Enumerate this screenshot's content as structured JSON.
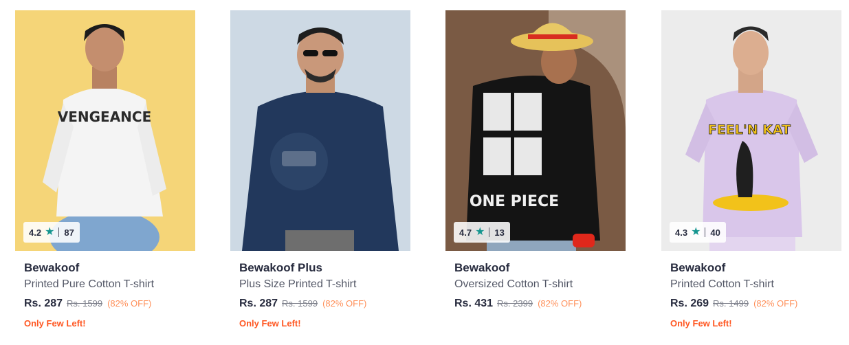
{
  "products": [
    {
      "brand": "Bewakoof",
      "title": "Printed Pure Cotton T-shirt",
      "price": "Rs. 287",
      "mrp": "Rs. 1599",
      "discount": "(82% OFF)",
      "stock_note": "Only Few Left!",
      "rating": "4.2",
      "rating_count": "87",
      "shirt_print": "VENGEANCE",
      "colors": {
        "bg": "#f2cf6b",
        "shirt": "#f4f4f4",
        "print": "#2a2a2a"
      }
    },
    {
      "brand": "Bewakoof Plus",
      "title": "Plus Size Printed T-shirt",
      "price": "Rs. 287",
      "mrp": "Rs. 1599",
      "discount": "(82% OFF)",
      "stock_note": "Only Few Left!",
      "colors": {
        "bg": "#cdd9e4",
        "shirt": "#22385c",
        "print": "#5d6f8a"
      }
    },
    {
      "brand": "Bewakoof",
      "title": "Oversized Cotton T-shirt",
      "price": "Rs. 431",
      "mrp": "Rs. 2399",
      "discount": "(82% OFF)",
      "stock_note": "",
      "rating": "4.7",
      "rating_count": "13",
      "shirt_print": "ONE PIECE",
      "colors": {
        "bg": "#7a5a44",
        "shirt": "#141414",
        "print": "#f0f0f0"
      }
    },
    {
      "brand": "Bewakoof",
      "title": "Printed Cotton T-shirt",
      "price": "Rs. 269",
      "mrp": "Rs. 1499",
      "discount": "(82% OFF)",
      "stock_note": "Only Few Left!",
      "rating": "4.3",
      "rating_count": "40",
      "shirt_print": "FEEL'N KAT",
      "colors": {
        "bg": "#ececec",
        "shirt": "#d9c6ea",
        "print": "#f2c21a"
      }
    }
  ],
  "icons": {
    "rating": "star-icon"
  }
}
